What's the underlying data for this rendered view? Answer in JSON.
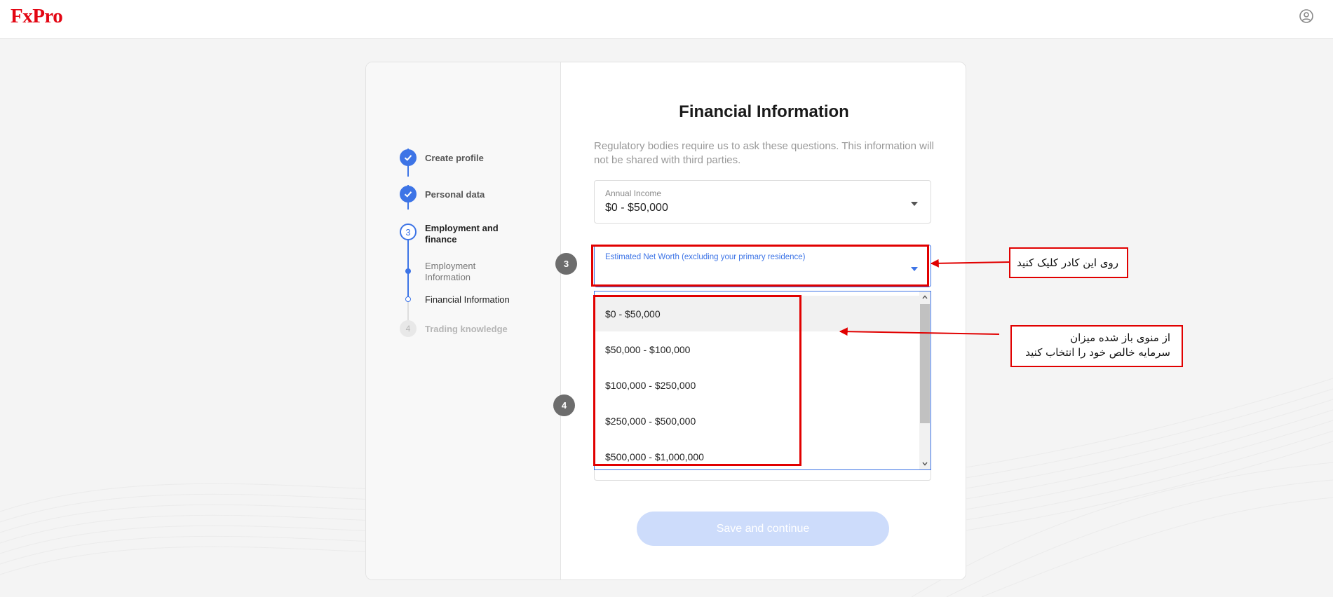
{
  "header": {
    "logo": "FxPro",
    "profile_icon": "user-circle-icon"
  },
  "steps": [
    {
      "label": "Create profile",
      "state": "done"
    },
    {
      "label": "Personal data",
      "state": "done"
    },
    {
      "number": "3",
      "label": "Employment and finance",
      "state": "active",
      "substeps": [
        {
          "label": "Employment Information",
          "state": "done"
        },
        {
          "label": "Financial Information",
          "state": "current"
        }
      ]
    },
    {
      "number": "4",
      "label": "Trading knowledge",
      "state": "pending"
    }
  ],
  "form": {
    "title": "Financial Information",
    "description": "Regulatory bodies require us to ask these questions. This information will not be shared with third parties.",
    "annual_income": {
      "label": "Annual Income",
      "value": "$0 - $50,000"
    },
    "net_worth": {
      "label": "Estimated Net Worth (excluding your primary residence)",
      "value": "",
      "options": [
        "$0 - $50,000",
        "$50,000 - $100,000",
        "$100,000 - $250,000",
        "$250,000 - $500,000",
        "$500,000 - $1,000,000"
      ],
      "hovered_option": "$0 - $50,000"
    },
    "save_label": "Save and continue"
  },
  "annotations": {
    "marker_3": "3",
    "marker_4": "4",
    "note_click": "روی این کادر کلیک کنید",
    "note_select_line1": "از منوی باز شده میزان",
    "note_select_line2": "سرمایه خالص خود را انتخاب کنید"
  },
  "colors": {
    "accent": "#3d74e6",
    "brand_red": "#e30613",
    "annotation_red": "#e10000",
    "button_disabled": "#cddcfb"
  }
}
